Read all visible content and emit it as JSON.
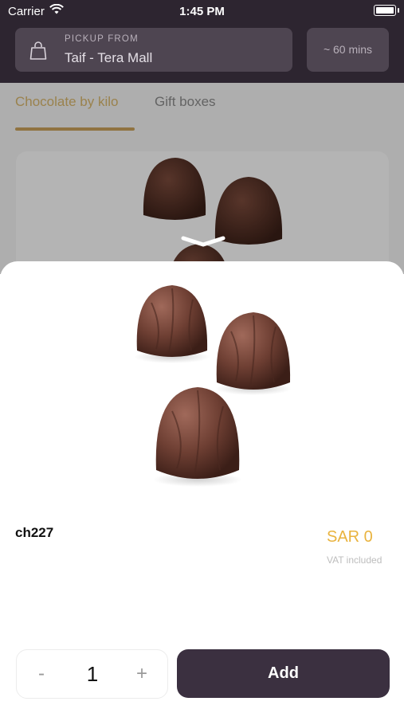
{
  "status_bar": {
    "carrier": "Carrier",
    "time": "1:45 PM"
  },
  "header": {
    "pickup_label": "PICKUP FROM",
    "pickup_location": "Taif - Tera Mall",
    "eta": "~ 60 mins"
  },
  "tabs": [
    {
      "label": "Chocolate by kilo",
      "active": true
    },
    {
      "label": "Gift boxes",
      "active": false
    }
  ],
  "product": {
    "name": "ch227",
    "price": "SAR 0",
    "vat_note": "VAT included"
  },
  "quantity": {
    "minus_label": "-",
    "value": "1",
    "plus_label": "+"
  },
  "add_button": {
    "label": "Add"
  },
  "colors": {
    "header_bg": "#2d2530",
    "accent": "#e9b33e",
    "add_button": "#3b3040"
  },
  "icons": [
    "wifi-icon",
    "battery-icon",
    "shopping-bag-icon",
    "chevron-down-icon"
  ]
}
